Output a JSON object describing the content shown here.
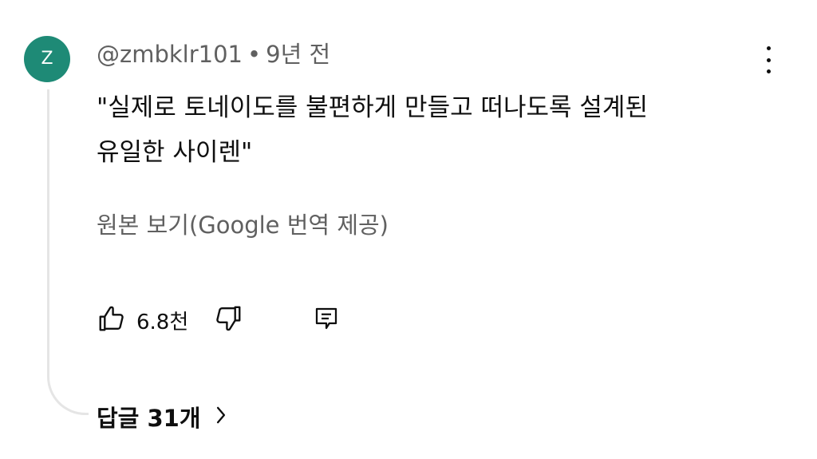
{
  "comment": {
    "avatar_letter": "Z",
    "avatar_color": "#1e8a76",
    "author": "@zmbklr101",
    "separator": "•",
    "time": "9년 전",
    "text_line1": "\"실제로 토네이도를 불편하게 만들고 떠나도록 설계된",
    "text_line2": "유일한 사이렌\"",
    "translate_link": "원본 보기(Google 번역 제공)",
    "like_count": "6.8천",
    "replies_label": "답글 31개",
    "icons": {
      "menu": "more-vert-icon",
      "like": "thumb-up-icon",
      "dislike": "thumb-down-icon",
      "reply": "reply-icon",
      "replies_chevron": "chevron-right-icon"
    }
  }
}
